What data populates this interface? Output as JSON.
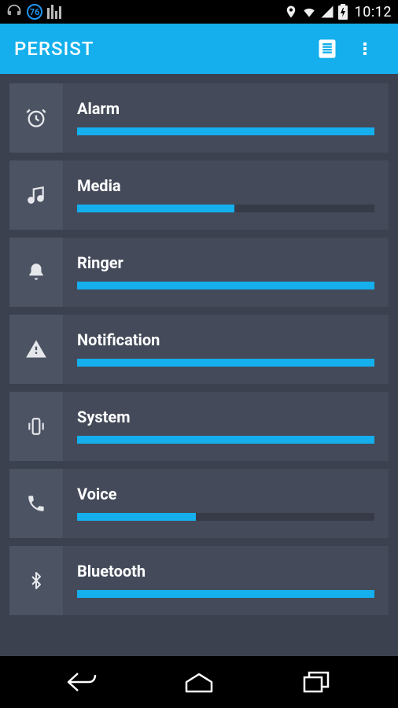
{
  "status": {
    "time": "10:12",
    "badge_number": "76"
  },
  "appbar": {
    "title": "PERSIST"
  },
  "volumes": [
    {
      "key": "alarm",
      "label": "Alarm",
      "percent": 100,
      "icon": "alarm-icon"
    },
    {
      "key": "media",
      "label": "Media",
      "percent": 53,
      "icon": "music-icon"
    },
    {
      "key": "ringer",
      "label": "Ringer",
      "percent": 100,
      "icon": "bell-icon"
    },
    {
      "key": "notification",
      "label": "Notification",
      "percent": 100,
      "icon": "warning-icon"
    },
    {
      "key": "system",
      "label": "System",
      "percent": 100,
      "icon": "phone-vibrate-icon"
    },
    {
      "key": "voice",
      "label": "Voice",
      "percent": 40,
      "icon": "call-icon"
    },
    {
      "key": "bluetooth",
      "label": "Bluetooth",
      "percent": 100,
      "icon": "bluetooth-icon"
    }
  ],
  "colors": {
    "accent": "#14afec",
    "row_bg": "#444a59",
    "icon_bg": "#4c5363",
    "page_bg": "#3b414f"
  }
}
